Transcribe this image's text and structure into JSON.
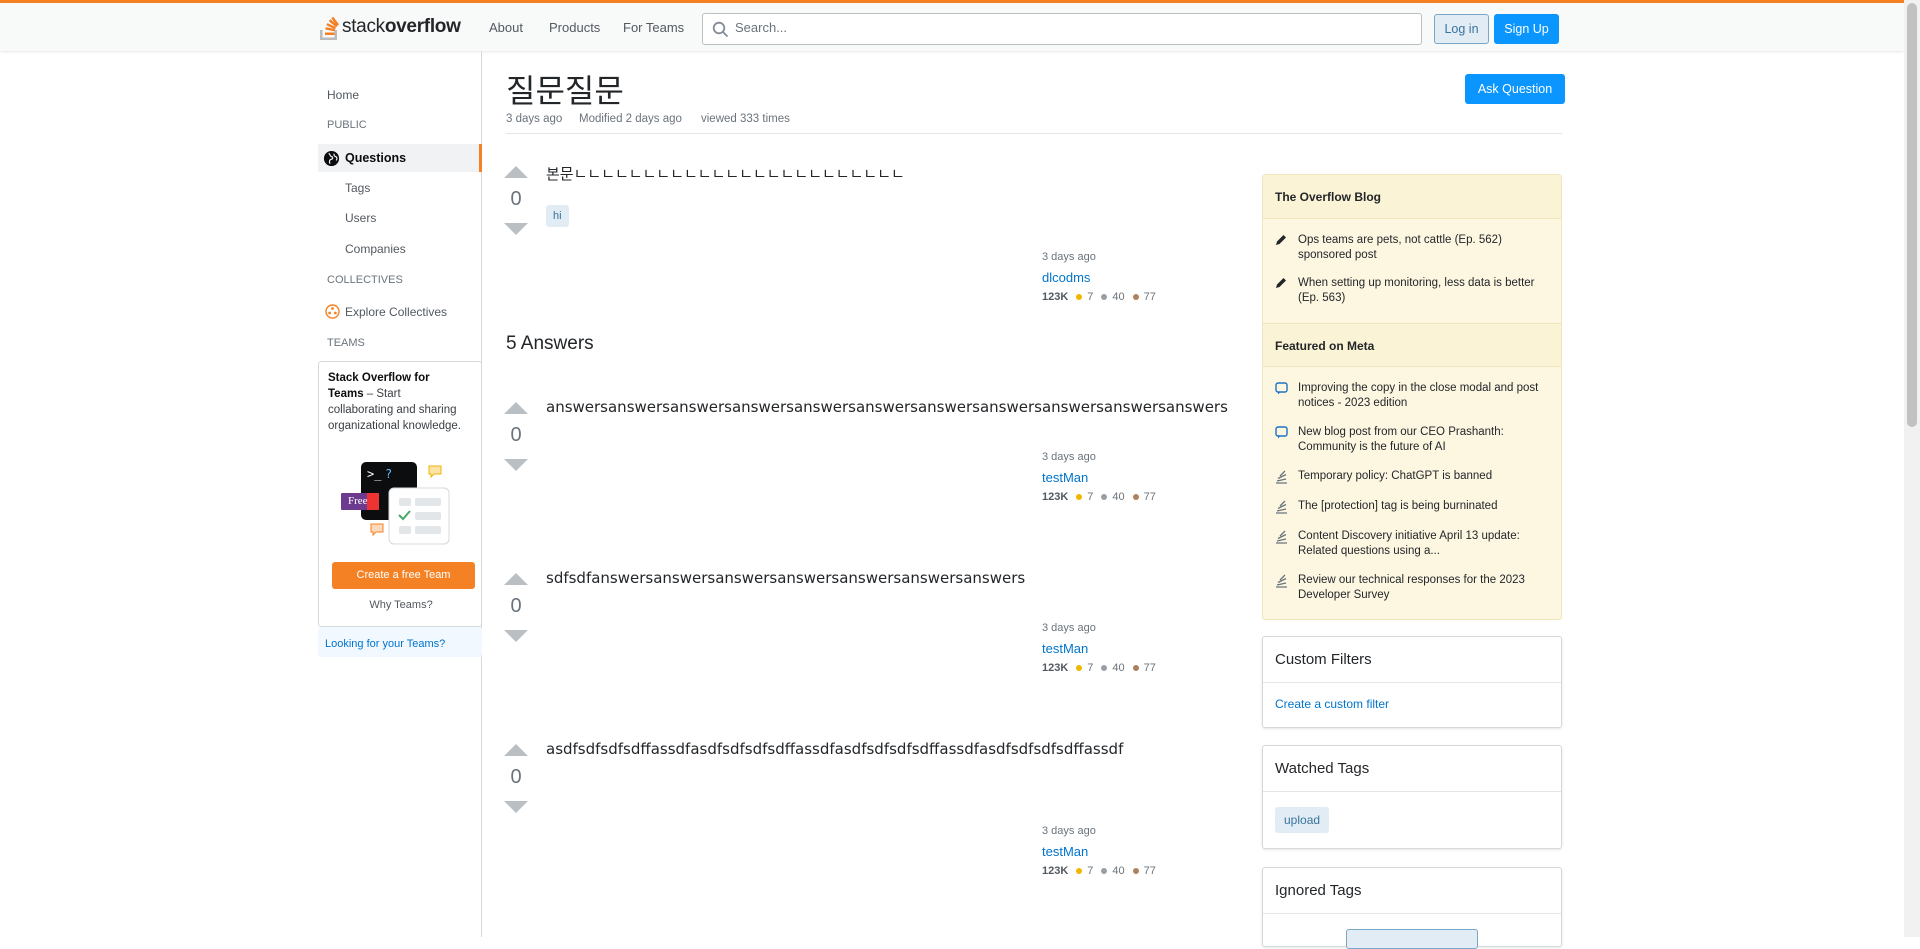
{
  "header": {
    "logo_light": "stack",
    "logo_bold": "overflow",
    "nav": [
      "About",
      "Products",
      "For Teams"
    ],
    "search_placeholder": "Search...",
    "login": "Log in",
    "signup": "Sign Up"
  },
  "sidebar": {
    "home": "Home",
    "public": "PUBLIC",
    "questions": "Questions",
    "tags": "Tags",
    "users": "Users",
    "companies": "Companies",
    "collectives": "COLLECTIVES",
    "explore_collectives": "Explore Collectives",
    "teams": "TEAMS",
    "teams_card_title": "Stack Overflow for Teams",
    "teams_card_text": " – Start collaborating and sharing organizational knowledge.",
    "free_badge": "Free",
    "create_team": "Create a free Team",
    "why_teams": "Why Teams?",
    "looking": "Looking for your Teams?"
  },
  "question": {
    "title": "질문질문",
    "asked": "3 days ago",
    "modified": "Modified 2 days ago",
    "viewed": "viewed 333 times",
    "ask_button": "Ask Question",
    "body": "본문ㄴㄴㄴㄴㄴㄴㄴㄴㄴㄴㄴㄴㄴㄴㄴㄴㄴㄴㄴㄴㄴㄴㄴㄴ",
    "votes": "0",
    "tag": "hi",
    "user": {
      "time": "3 days ago",
      "name": "dlcodms",
      "rep": "123K",
      "gold": "7",
      "silver": "40",
      "bronze": "77"
    }
  },
  "answers_heading": "5 Answers",
  "answers": [
    {
      "body": "answersanswersanswersanswersanswersanswersanswersanswersanswersanswersanswers",
      "votes": "0",
      "time": "3 days ago",
      "name": "testMan",
      "rep": "123K",
      "gold": "7",
      "silver": "40",
      "bronze": "77"
    },
    {
      "body": "sdfsdfanswersanswersanswersanswersanswersanswersanswers",
      "votes": "0",
      "time": "3 days ago",
      "name": "testMan",
      "rep": "123K",
      "gold": "7",
      "silver": "40",
      "bronze": "77"
    },
    {
      "body": "asdfsdfsdfsdffassdfasdfsdfsdfsdffassdfasdfsdfsdfsdffassdfasdfsdfsdfsdffassdf",
      "votes": "0",
      "time": "3 days ago",
      "name": "testMan",
      "rep": "123K",
      "gold": "7",
      "silver": "40",
      "bronze": "77"
    }
  ],
  "blog": {
    "heading": "The Overflow Blog",
    "items": [
      "Ops teams are pets, not cattle (Ep. 562) sponsored post",
      "When setting up monitoring, less data is better (Ep. 563)"
    ],
    "meta_heading": "Featured on Meta",
    "meta_items": [
      "Improving the copy in the close modal and post notices - 2023 edition",
      "New blog post from our CEO Prashanth: Community is the future of AI",
      "Temporary policy: ChatGPT is banned",
      "The [protection] tag is being burninated",
      "Content Discovery initiative April 13 update: Related questions using a...",
      "Review our technical responses for the 2023 Developer Survey"
    ]
  },
  "custom_filters": {
    "heading": "Custom Filters",
    "link": "Create a custom filter"
  },
  "watched_tags": {
    "heading": "Watched Tags",
    "tag": "upload"
  },
  "ignored_tags": {
    "heading": "Ignored Tags"
  },
  "colors": {
    "accent": "#f48225",
    "primary": "#0a95ff",
    "link": "#0074cc",
    "gold": "#f1b600",
    "silver": "#9a9fa5",
    "bronze": "#ab825f"
  }
}
